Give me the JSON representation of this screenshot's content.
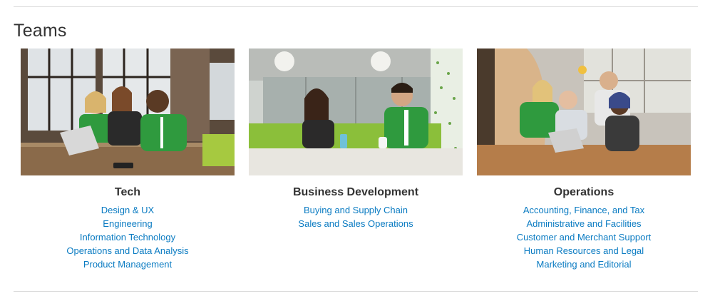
{
  "section": {
    "title": "Teams"
  },
  "teams": [
    {
      "name": "Tech",
      "photo": "team-tech-photo",
      "links": [
        "Design & UX",
        "Engineering",
        "Information Technology",
        "Operations and Data Analysis",
        "Product Management"
      ]
    },
    {
      "name": "Business Development",
      "photo": "team-business-development-photo",
      "links": [
        "Buying and Supply Chain",
        "Sales and Sales Operations"
      ]
    },
    {
      "name": "Operations",
      "photo": "team-operations-photo",
      "links": [
        "Accounting, Finance, and Tax",
        "Administrative and Facilities",
        "Customer and Merchant Support",
        "Human Resources and Legal",
        "Marketing and Editorial"
      ]
    }
  ],
  "colors": {
    "link": "#0a7bc2",
    "heading": "#333333",
    "rule": "#d9d9d9",
    "jacket_green": "#2f9a3e"
  }
}
